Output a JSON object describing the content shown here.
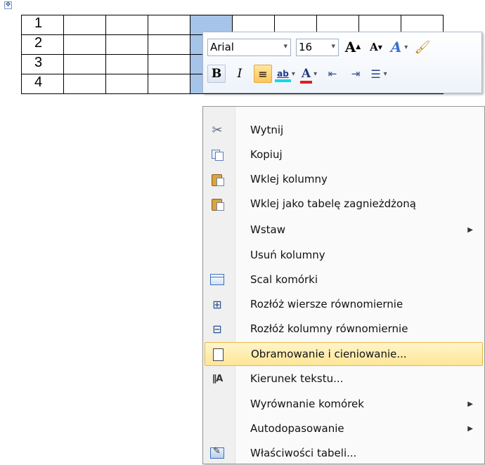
{
  "table": {
    "row_numbers": [
      "1",
      "2",
      "3",
      "4"
    ]
  },
  "mini_toolbar": {
    "font_name": "Arial",
    "font_size": "16",
    "grow_font_glyph": "A",
    "shrink_font_glyph": "A",
    "styles_glyph": "A",
    "bold_glyph": "B",
    "italic_glyph": "I",
    "highlight_glyph": "ab",
    "font_color_glyph": "A"
  },
  "context_menu": {
    "items": [
      {
        "label": "Wytnij",
        "icon": "scissors-icon"
      },
      {
        "label": "Kopiuj",
        "icon": "copy-icon"
      },
      {
        "label": "Wklej kolumny",
        "icon": "paste-icon"
      },
      {
        "label": "Wklej jako tabelę zagnieżdżoną",
        "icon": "paste-nested-icon"
      },
      {
        "label": "Wstaw",
        "icon": null,
        "submenu": true
      },
      {
        "label": "Usuń kolumny",
        "icon": null
      },
      {
        "label": "Scal komórki",
        "icon": "merge-cells-icon"
      },
      {
        "label": "Rozłóż wiersze równomiernie",
        "icon": "distribute-rows-icon"
      },
      {
        "label": "Rozłóż kolumny równomiernie",
        "icon": "distribute-columns-icon"
      },
      {
        "label": "Obramowanie i cieniowanie...",
        "icon": "borders-icon",
        "highlighted": true
      },
      {
        "label": "Kierunek tekstu...",
        "icon": "text-direction-icon"
      },
      {
        "label": "Wyrównanie komórek",
        "icon": null,
        "submenu": true
      },
      {
        "label": "Autodopasowanie",
        "icon": null,
        "submenu": true
      },
      {
        "label": "Właściwości tabeli...",
        "icon": "table-properties-icon"
      }
    ]
  }
}
